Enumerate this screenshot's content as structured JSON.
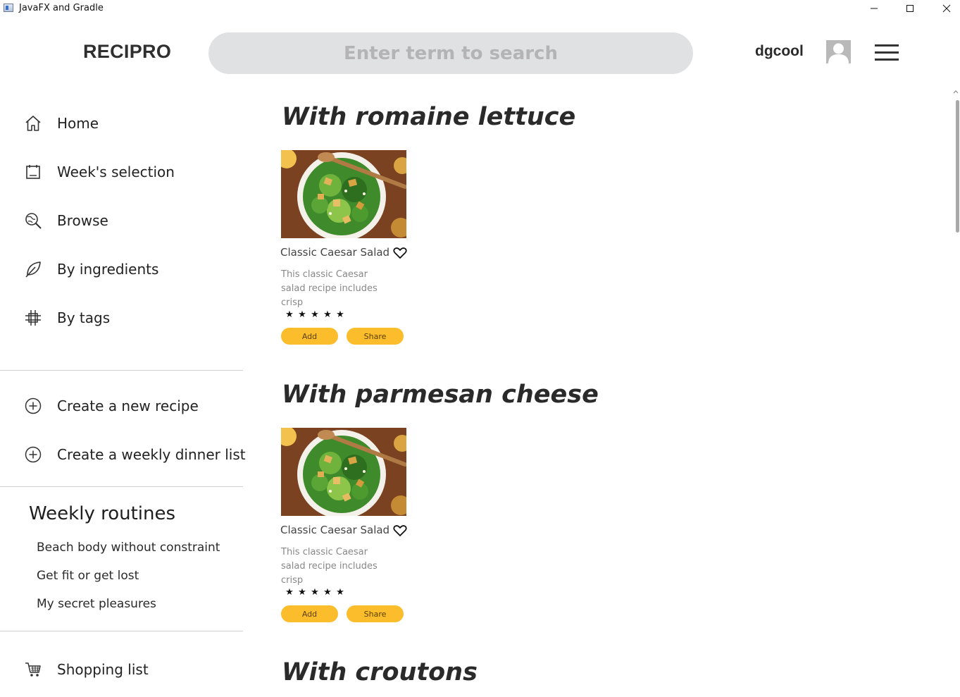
{
  "window": {
    "title": "JavaFX and Gradle"
  },
  "header": {
    "logo": "RECIPRO",
    "search_placeholder": "Enter term to search",
    "username": "dgcool"
  },
  "sidebar": {
    "nav": [
      {
        "label": "Home",
        "icon": "home-icon"
      },
      {
        "label": "Week's selection",
        "icon": "calendar-icon"
      },
      {
        "label": "Browse",
        "icon": "browse-icon"
      },
      {
        "label": "By ingredients",
        "icon": "leaf-icon"
      },
      {
        "label": "By tags",
        "icon": "hashtag-icon"
      }
    ],
    "create": [
      {
        "label": "Create a new recipe",
        "icon": "plus-circle-icon"
      },
      {
        "label": "Create a weekly dinner list",
        "icon": "plus-circle-icon"
      }
    ],
    "weekly_routines_heading": "Weekly routines",
    "routines": [
      "Beach body without constraint",
      "Get fit or get lost",
      "My secret pleasures"
    ],
    "shopping": {
      "label": "Shopping list",
      "icon": "cart-icon"
    }
  },
  "main": {
    "sections": [
      {
        "heading": "With romaine lettuce",
        "cards": [
          {
            "title": "Classic Caesar Salad",
            "description": "This classic Caesar salad recipe includes crisp",
            "rating": 5,
            "add_label": "Add",
            "share_label": "Share"
          }
        ]
      },
      {
        "heading": "With parmesan cheese",
        "cards": [
          {
            "title": "Classic Caesar Salad",
            "description": "This classic Caesar salad recipe includes crisp",
            "rating": 5,
            "add_label": "Add",
            "share_label": "Share"
          }
        ]
      },
      {
        "heading": "With croutons",
        "cards": []
      }
    ]
  },
  "colors": {
    "accent": "#fbbd2c",
    "search_bg": "#e0e1e3",
    "text": "#222222"
  }
}
